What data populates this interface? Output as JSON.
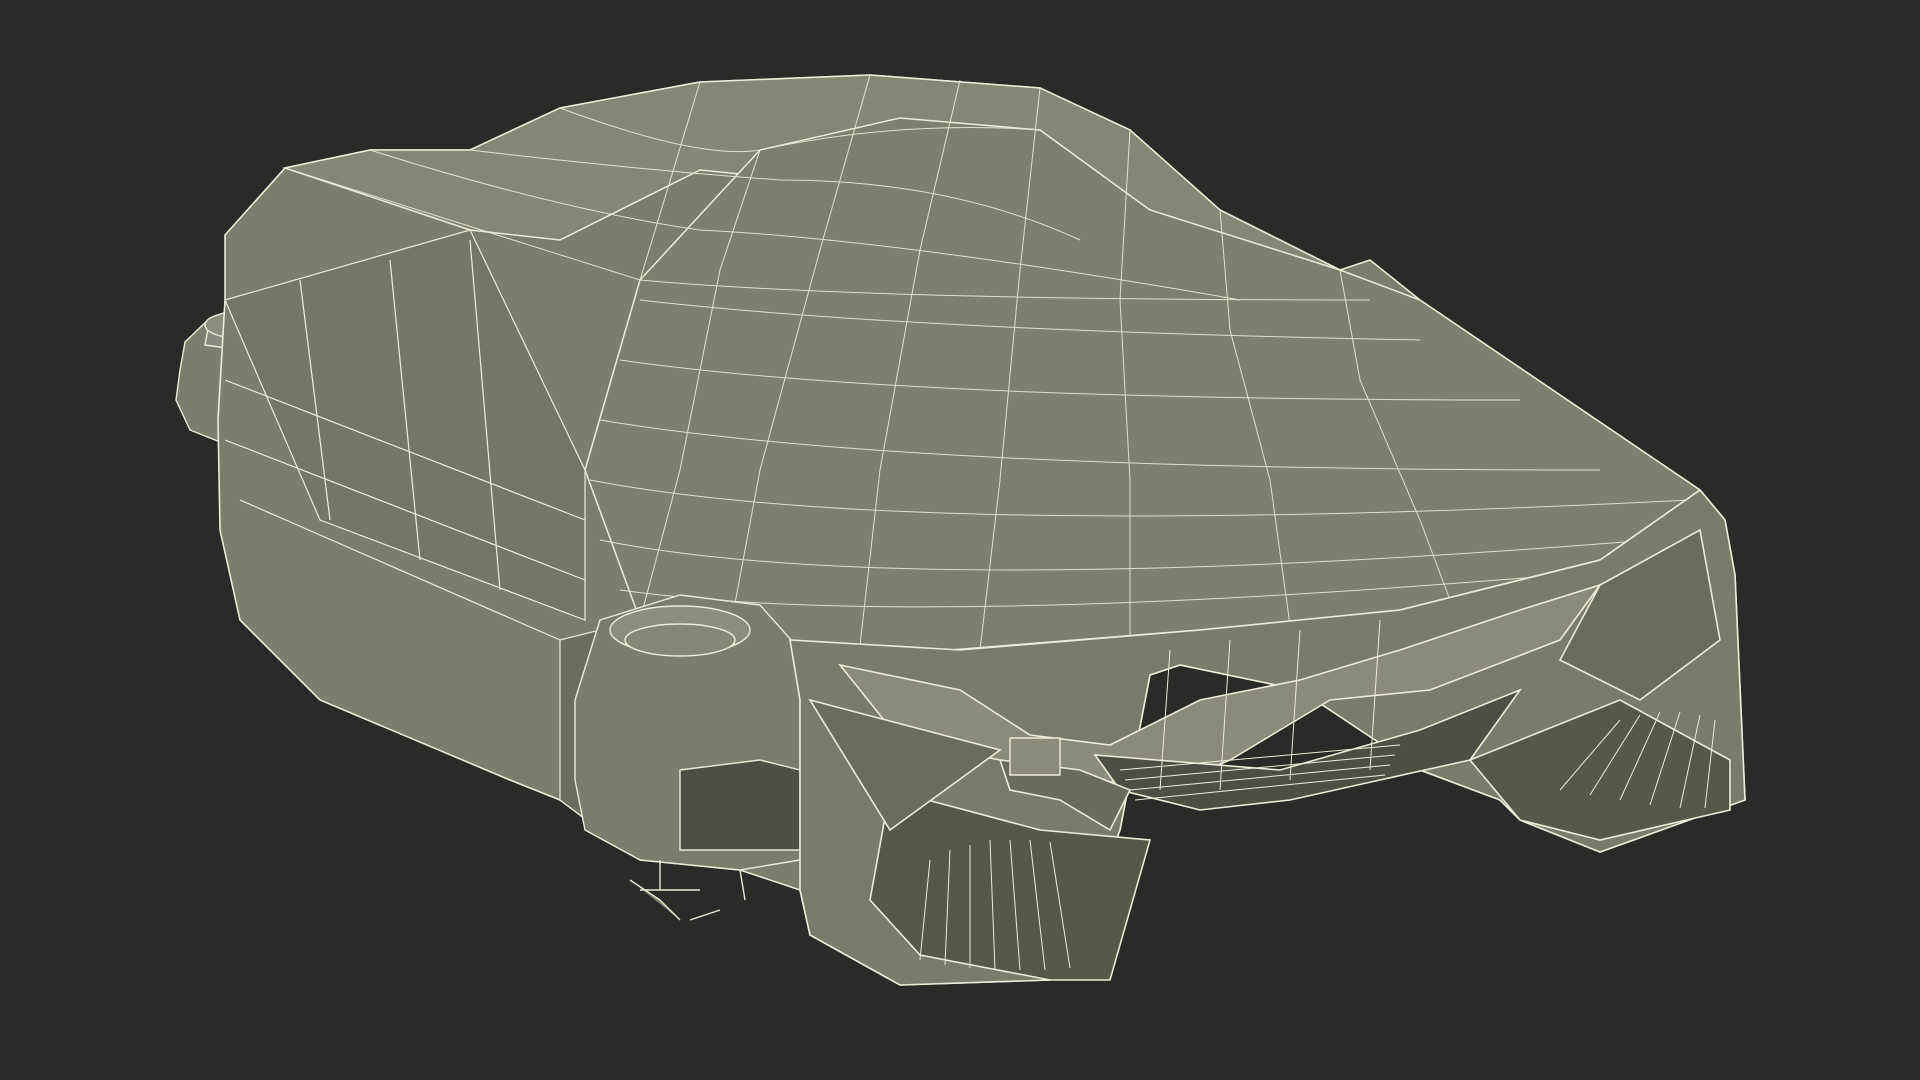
{
  "scene": {
    "subject": "wireframe-3d-model-hover-car",
    "colors": {
      "background": "#2a2a29",
      "surface": "#7c7e6c",
      "surface_shadow": "#626453",
      "surface_dark": "#4d4f42",
      "wire": "#ecebd6"
    }
  }
}
